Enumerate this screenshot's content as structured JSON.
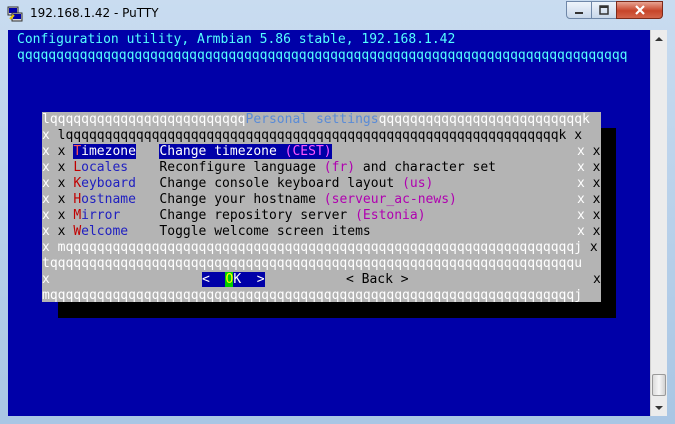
{
  "window": {
    "title": "192.168.1.42 - PuTTY",
    "accent": "#c7452a"
  },
  "terminal": {
    "header": "Configuration utility, Armbian 5.86 stable, 192.168.1.42",
    "header_rule": "qqqqqqqqqqqqqqqqqqqqqqqqqqqqqqqqqqqqqqqqqqqqqqqqqqqqqqqqqqqqqqqqqqqqqqqqqqqqqq",
    "background": "#0000a8",
    "fg_cyan": "#55ffff"
  },
  "dialog": {
    "top_left_rule": "lqqqqqqqqqqqqqqqqqqqqqqqqq",
    "title": "Personal settings",
    "top_right_rule": "qqqqqqqqqqqqqqqqqqqqqqqqqqk",
    "inner_top": " lqqqqqqqqqqqqqqqqqqqqqqqqqqqqqqqqqqqqqqqqqqqqqqqqqqqqqqqqqqqqqqqk ",
    "inner_bottom": " mqqqqqqqqqqqqqqqqqqqqqqqqqqqqqqqqqqqqqqqqqqqqqqqqqqqqqqqqqqqqqqqqqj ",
    "separator": "tqqqqqqqqqqqqqqqqqqqqqqqqqqqqqqqqqqqqqqqqqqqqqqqqqqqqqqqqqqqqqqqqqqqu",
    "bottom_rule": "mqqqqqqqqqqqqqqqqqqqqqqqqqqqqqqqqqqqqqqqqqqqqqqqqqqqqqqqqqqqqqqqqqqqj",
    "edge": "x",
    "items": [
      {
        "hot": "T",
        "rest": "imezone",
        "desc": "Change timezone ",
        "value": "(CEST)",
        "desc2": ""
      },
      {
        "hot": "L",
        "rest": "ocales",
        "desc": "Reconfigure language ",
        "value": "(fr)",
        "desc2": " and character set"
      },
      {
        "hot": "K",
        "rest": "eyboard",
        "desc": "Change console keyboard layout ",
        "value": "(us)",
        "desc2": ""
      },
      {
        "hot": "H",
        "rest": "ostname",
        "desc": "Change your hostname ",
        "value": "(serveur_ac-news)",
        "desc2": ""
      },
      {
        "hot": "M",
        "rest": "irror",
        "desc": "Change repository server ",
        "value": "(Estonia)",
        "desc2": ""
      },
      {
        "hot": "W",
        "rest": "elcome",
        "desc": "Toggle welcome screen items",
        "value": "",
        "desc2": ""
      }
    ],
    "ok_left": "<  ",
    "ok_hot": "O",
    "ok_right": "K  >",
    "back_label": "< Back >"
  }
}
